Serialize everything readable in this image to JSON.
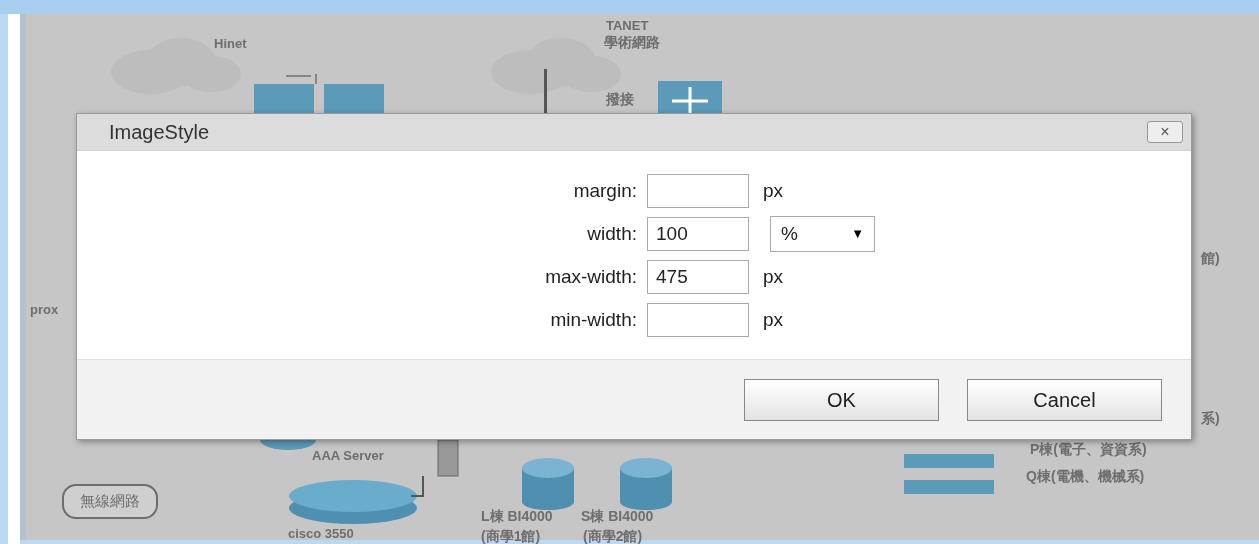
{
  "diagram": {
    "labels": [
      {
        "kind": "plain",
        "text": "Hinet"
      },
      {
        "kind": "plain",
        "text": "TANET"
      },
      {
        "kind": "cjk",
        "text": "學術網路"
      },
      {
        "kind": "cjk",
        "text": "撥接"
      },
      {
        "kind": "plain",
        "text": "prox"
      },
      {
        "kind": "cjk",
        "text": "館)"
      },
      {
        "kind": "cjk",
        "text": "系)"
      },
      {
        "kind": "cjk",
        "text": "P棟(電子、資資系)"
      },
      {
        "kind": "cjk",
        "text": "Q棟(電機、機械系)"
      },
      {
        "kind": "plain",
        "text": "AAA Server"
      },
      {
        "kind": "cloud",
        "text": "無線網路"
      },
      {
        "kind": "plain",
        "text": "cisco 3550"
      },
      {
        "kind": "cjk",
        "text": "L棟 BI4000"
      },
      {
        "kind": "cjk",
        "text": "(商學1館)"
      },
      {
        "kind": "cjk",
        "text": "S棟 BI4000"
      },
      {
        "kind": "cjk",
        "text": "(商學2館)"
      }
    ]
  },
  "dialog": {
    "title": "ImageStyle",
    "close": "×",
    "fields": [
      {
        "kind": "text",
        "label": "margin:",
        "unit": "px"
      },
      {
        "kind": "select",
        "label": "width:",
        "value": "100",
        "unit": "%",
        "caret": "▼"
      },
      {
        "kind": "text",
        "label": "max-width:",
        "value": "475",
        "unit": "px"
      },
      {
        "kind": "text",
        "label": "min-width:",
        "unit": "px"
      }
    ],
    "buttons": [
      "OK",
      "Cancel"
    ]
  }
}
